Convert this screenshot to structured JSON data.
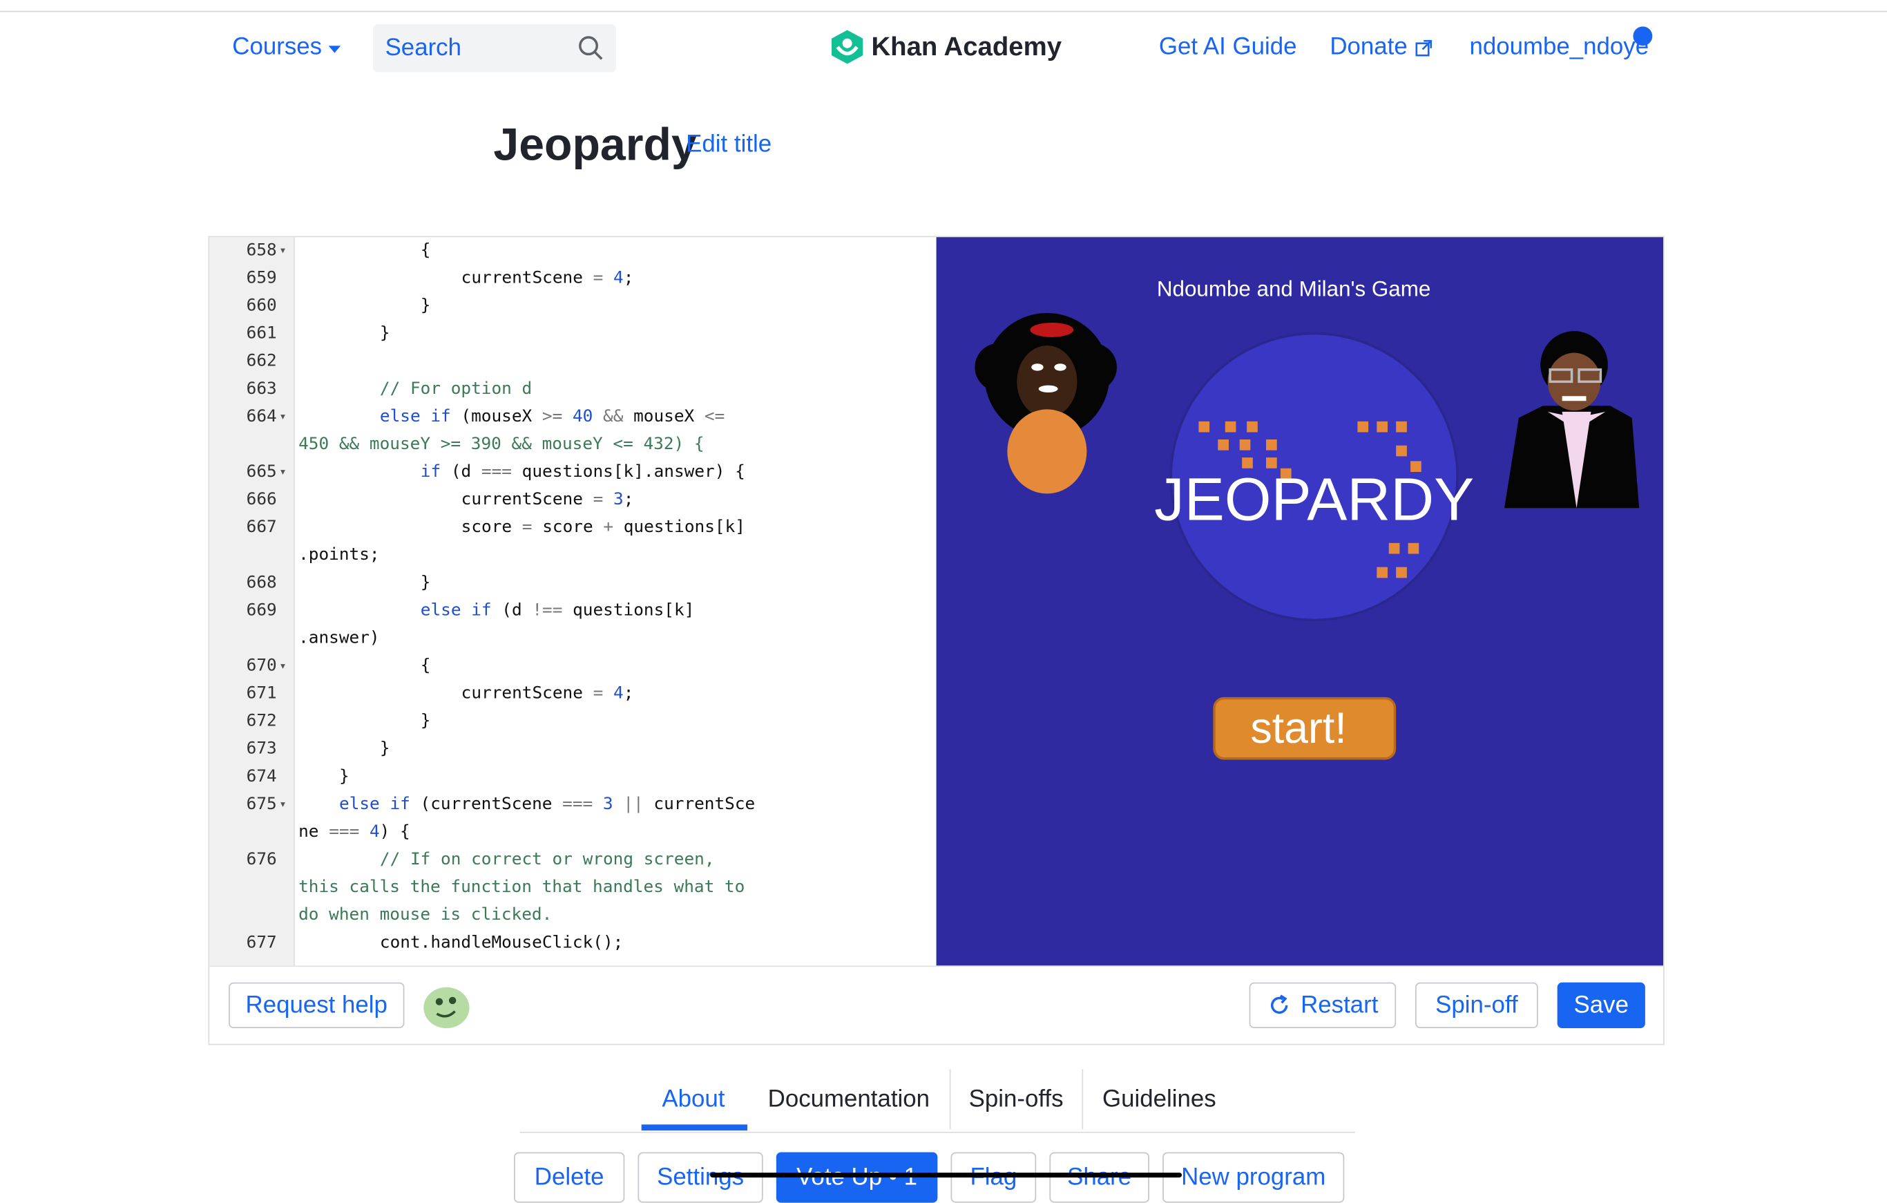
{
  "nav": {
    "courses": "Courses",
    "search_placeholder": "Search",
    "logo": "Khan Academy",
    "ai_guide": "Get AI Guide",
    "donate": "Donate",
    "user": "ndoumbe_ndoye"
  },
  "page": {
    "title": "Jeopardy",
    "edit_title": "Edit title"
  },
  "code_lines": [
    {
      "n": "658",
      "t": "            {"
    },
    {
      "n": "659",
      "t": "                currentScene = 4;"
    },
    {
      "n": "660",
      "t": "            }"
    },
    {
      "n": "661",
      "t": "        }"
    },
    {
      "n": "662",
      "t": ""
    },
    {
      "n": "663",
      "t": "        // For option d"
    },
    {
      "n": "664",
      "t": "        else if (mouseX >= 40 && mouseX <="
    },
    {
      "n": "",
      "t": "450 && mouseY >= 390 && mouseY <= 432) {"
    },
    {
      "n": "665",
      "t": "            if (d === questions[k].answer) {"
    },
    {
      "n": "666",
      "t": "                currentScene = 3;"
    },
    {
      "n": "667",
      "t": "                score = score + questions[k]"
    },
    {
      "n": "",
      "t": ".points;"
    },
    {
      "n": "668",
      "t": "            }"
    },
    {
      "n": "669",
      "t": "            else if (d !== questions[k]"
    },
    {
      "n": "",
      "t": ".answer)"
    },
    {
      "n": "670",
      "t": "            {"
    },
    {
      "n": "671",
      "t": "                currentScene = 4;"
    },
    {
      "n": "672",
      "t": "            }"
    },
    {
      "n": "673",
      "t": "        }"
    },
    {
      "n": "674",
      "t": "    }"
    },
    {
      "n": "675",
      "t": "    else if (currentScene === 3 || currentSce"
    },
    {
      "n": "",
      "t": "ne === 4) {"
    },
    {
      "n": "676",
      "t": "        // If on correct or wrong screen,"
    },
    {
      "n": "",
      "t": "this calls the function that handles what to"
    },
    {
      "n": "",
      "t": "do when mouse is clicked."
    },
    {
      "n": "677",
      "t": "        cont.handleMouseClick();"
    }
  ],
  "canvas": {
    "subtitle": "Ndoumbe and Milan's Game",
    "logo_text": "JEOPARDY",
    "start": "start!"
  },
  "toolbar": {
    "request_help": "Request help",
    "restart": "Restart",
    "spinoff": "Spin-off",
    "save": "Save"
  },
  "tabs": [
    "About",
    "Documentation",
    "Spin-offs",
    "Guidelines"
  ],
  "actions": [
    "Delete",
    "Settings",
    "Vote Up • 1",
    "Flag",
    "Share",
    "New program"
  ],
  "colors": {
    "accent": "#1865f2",
    "canvas_bg": "#2f2aa0",
    "start_btn": "#e08a2e"
  }
}
